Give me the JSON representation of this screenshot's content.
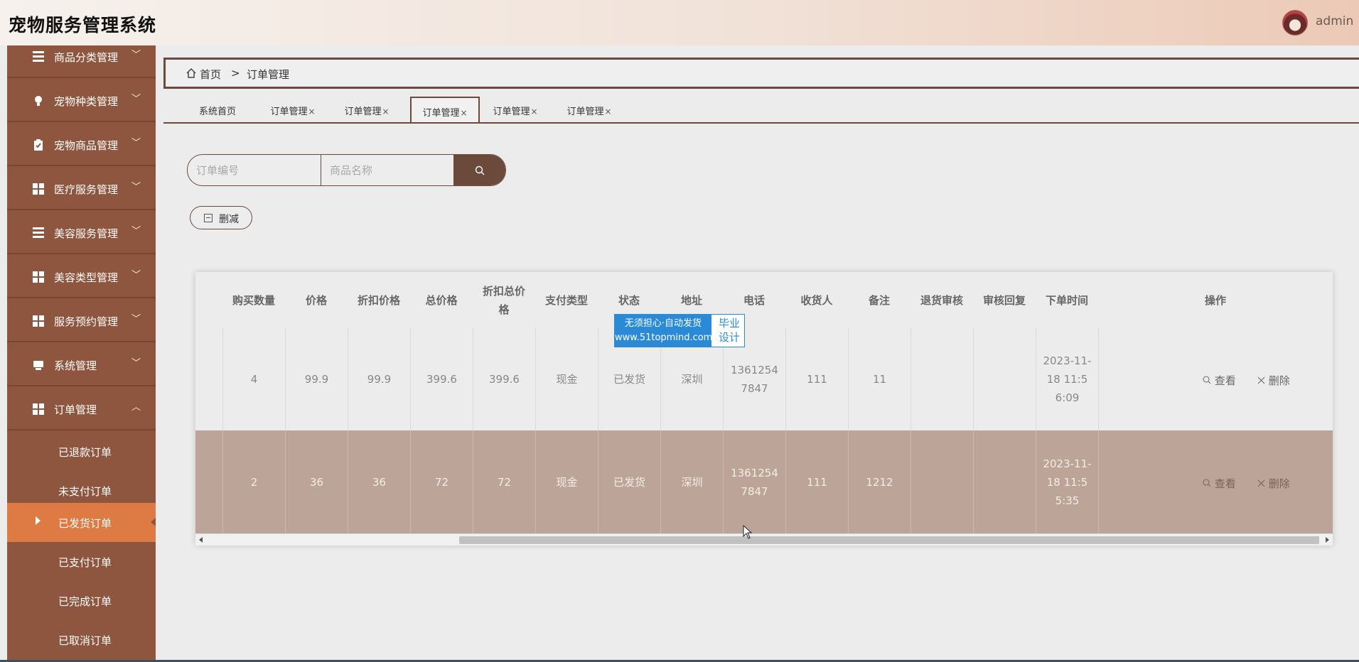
{
  "header": {
    "title": "宠物服务管理系统",
    "user": "admin"
  },
  "sidebar": {
    "items": [
      {
        "label": "商品分类管理",
        "icon": "lines-icon"
      },
      {
        "label": "宠物种类管理",
        "icon": "bulb-icon"
      },
      {
        "label": "宠物商品管理",
        "icon": "clipboard-icon"
      },
      {
        "label": "医疗服务管理",
        "icon": "grid-icon"
      },
      {
        "label": "美容服务管理",
        "icon": "lines-icon"
      },
      {
        "label": "美容类型管理",
        "icon": "grid-icon"
      },
      {
        "label": "服务预约管理",
        "icon": "grid-icon"
      },
      {
        "label": "系统管理",
        "icon": "monitor-icon"
      },
      {
        "label": "订单管理",
        "icon": "grid-icon"
      }
    ],
    "sub_items": [
      "已退款订单",
      "未支付订单",
      "已发货订单",
      "已支付订单",
      "已完成订单",
      "已取消订单"
    ],
    "active_sub": "已发货订单"
  },
  "breadcrumb": {
    "home": "首页",
    "sep": ">",
    "current": "订单管理"
  },
  "tabs": [
    "系统首页",
    "订单管理",
    "订单管理",
    "订单管理",
    "订单管理",
    "订单管理"
  ],
  "tab_close": "×",
  "search": {
    "order_no_placeholder": "订单编号",
    "product_placeholder": "商品名称"
  },
  "delete_button": "删减",
  "table": {
    "headers": [
      "购买数量",
      "价格",
      "折扣价格",
      "总价格",
      "折扣总价格",
      "支付类型",
      "状态",
      "地址",
      "电话",
      "收货人",
      "备注",
      "退货审核",
      "审核回复",
      "下单时间",
      "操作"
    ],
    "rows": [
      [
        "4",
        "99.9",
        "99.9",
        "399.6",
        "399.6",
        "现金",
        "已发货",
        "深圳",
        "13612547847",
        "111",
        "11",
        "",
        "",
        "2023-11-18 11:56:09"
      ],
      [
        "2",
        "36",
        "36",
        "72",
        "72",
        "现金",
        "已发货",
        "深圳",
        "13612547847",
        "111",
        "1212",
        "",
        "",
        "2023-11-18 11:55:35"
      ]
    ],
    "view_label": "查看",
    "delete_label": "删除"
  },
  "watermark": {
    "line1": "无须担心·自动发货",
    "line2": "www.51topmind.com",
    "side": "毕业设计"
  }
}
